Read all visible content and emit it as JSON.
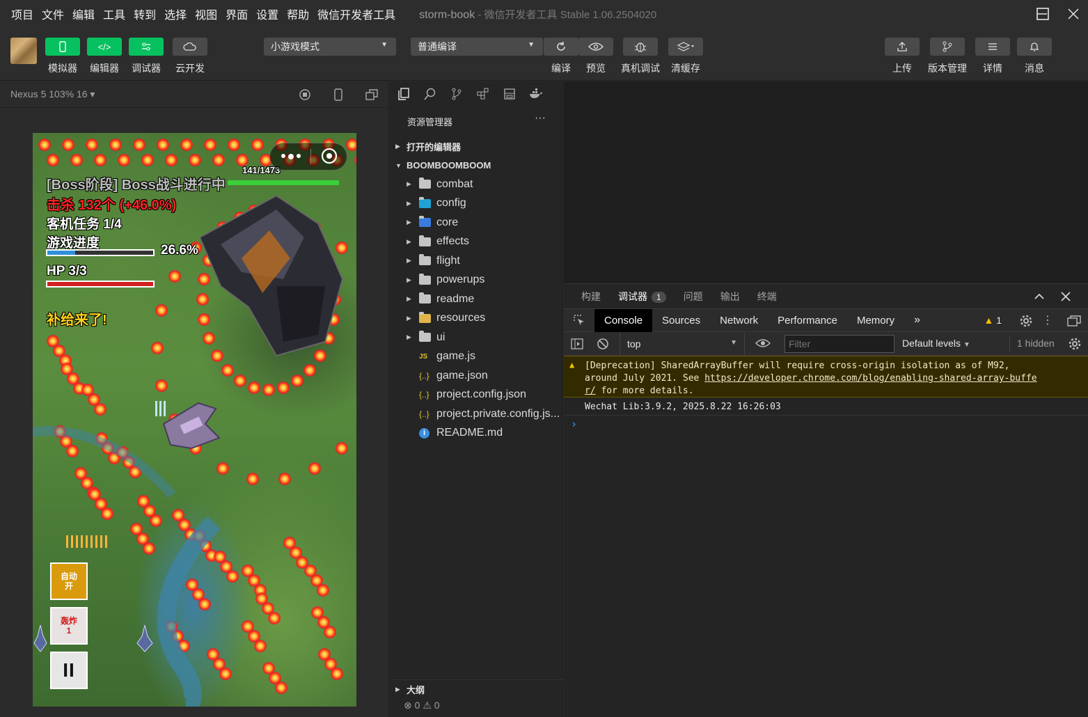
{
  "menu": [
    "项目",
    "文件",
    "编辑",
    "工具",
    "转到",
    "选择",
    "视图",
    "界面",
    "设置",
    "帮助",
    "微信开发者工具"
  ],
  "window": {
    "project": "storm-book",
    "separator": " - ",
    "app": "微信开发者工具 Stable 1.06.2504020"
  },
  "toolbar": {
    "simulator": "模拟器",
    "editor": "编辑器",
    "debugger": "调试器",
    "cloud": "云开发",
    "mode": "小游戏模式",
    "compile_mode": "普通编译",
    "compile": "编译",
    "preview": "预览",
    "real_debug": "真机调试",
    "clear_cache": "清缓存",
    "upload": "上传",
    "version": "版本管理",
    "details": "详情",
    "messages": "消息"
  },
  "simulator": {
    "device": "Nexus 5 103% 16 ▾"
  },
  "game": {
    "boss_label": "[Boss阶段] Boss战斗进行中",
    "boss_hp": "141",
    "boss_hp_max": "1473",
    "kills": "击杀 132个 (+46.0%)",
    "task": "客机任务 1/4",
    "progress_label": "游戏进度",
    "progress_value": "26.6%",
    "progress": 0.266,
    "hp_label": "HP 3/3",
    "hp": 1.0,
    "supply": "补给来了!",
    "auto_btn": "自动\n开",
    "bomb_btn": "轰炸\n1",
    "pause": "II"
  },
  "explorer": {
    "title": "资源管理器",
    "more": "···",
    "open_editors": "打开的编辑器",
    "project": "BOOMBOOMBOOM",
    "folders": [
      "combat",
      "config",
      "core",
      "effects",
      "flight",
      "powerups",
      "readme",
      "resources",
      "ui"
    ],
    "files": [
      {
        "name": "game.js",
        "icon": "js-icon"
      },
      {
        "name": "game.json",
        "icon": "json-icon"
      },
      {
        "name": "project.config.json",
        "icon": "json-icon"
      },
      {
        "name": "project.private.config.js...",
        "icon": "json-icon"
      },
      {
        "name": "README.md",
        "icon": "info-icon"
      }
    ],
    "outline": "大纲",
    "errors": "0",
    "warnings": "0"
  },
  "devtools": {
    "tabs": [
      "构建",
      "调试器",
      "问题",
      "输出",
      "终端"
    ],
    "active_tab": "调试器",
    "badge": "1",
    "cdt_tabs": [
      "Console",
      "Sources",
      "Network",
      "Performance",
      "Memory"
    ],
    "warn_count": "1",
    "context": "top",
    "filter_placeholder": "Filter",
    "levels": "Default levels",
    "hidden": "1 hidden",
    "warning_text_1": "[Deprecation] SharedArrayBuffer will require cross-origin isolation as of M92,",
    "warning_text_2": "around July 2021. See ",
    "warning_link_1": "https://developer.chrome.com/blog/enabling-shared-array-buffe",
    "warning_link_2": "r/",
    "warning_text_3": " for more details.",
    "log": "Wechat Lib:3.9.2, 2025.8.22 16:26:03",
    "prompt": "›"
  },
  "colors": {
    "accent_green": "#07c160",
    "warning_bg": "#332b00",
    "boss_hp_bar": "#3ad03a",
    "progress_fill": "#2f8fd8",
    "hp_fill": "#d02020"
  }
}
